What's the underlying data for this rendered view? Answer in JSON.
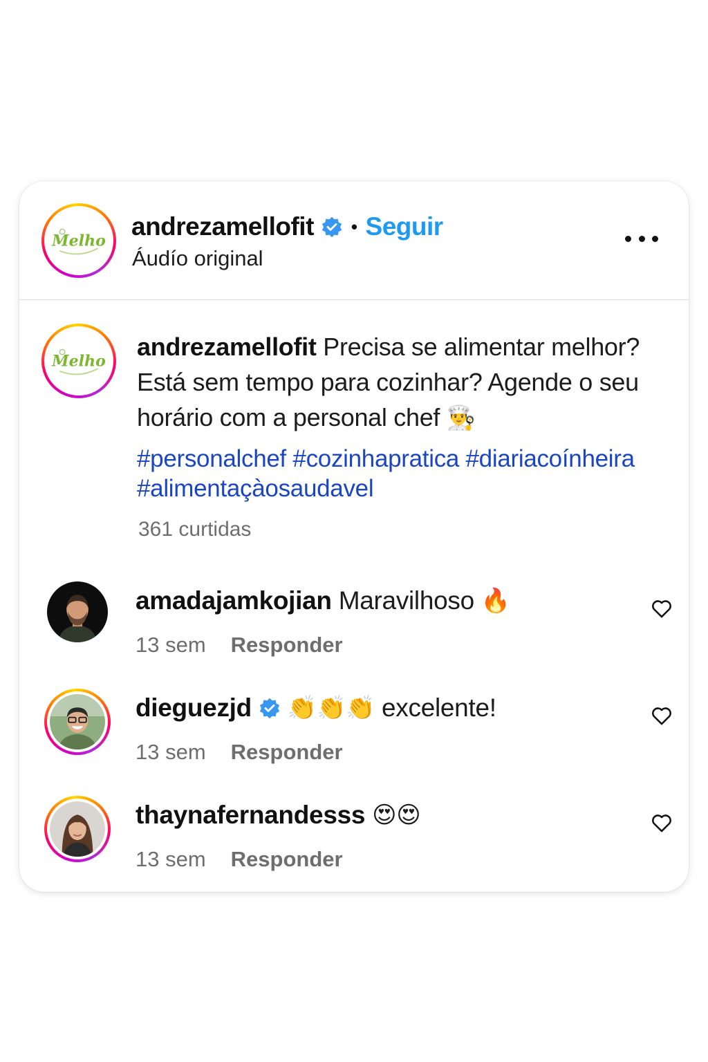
{
  "post": {
    "username": "andrezamellofit",
    "verified": true,
    "separator": "•",
    "follow_label": "Seguir",
    "audio_label": "Áudío original",
    "avatar_logo_text": "Melho",
    "more_icon": "more-horizontal-icon"
  },
  "caption": {
    "username": "andrezamellofit",
    "text": "Precisa se alimentar melhor? Está sem tempo para cozinhar? Agende o seu horário com a personal chef",
    "emoji": "👨‍🍳",
    "hashtags": [
      "#personalchef",
      "#cozinhapratica",
      "#diariacoínheira",
      "#alimentaçàosaudavel"
    ],
    "likes": "361 curtidas"
  },
  "comments": [
    {
      "username": "amadajamkojian",
      "verified": false,
      "text": "Maravilhoso",
      "emoji": "🔥",
      "time": "13 sem",
      "reply_label": "Responder"
    },
    {
      "username": "dieguezjd",
      "verified": true,
      "emoji": "👏👏👏",
      "text": "excelente!",
      "time": "13 sem",
      "reply_label": "Responder"
    },
    {
      "username": "thaynafernandesss",
      "verified": false,
      "emoji": "😍😍",
      "text": "",
      "time": "13 sem",
      "reply_label": "Responder"
    }
  ],
  "colors": {
    "accent_blue": "#1e9bf0",
    "hashtag_blue": "#1b46c2",
    "verified_blue": "#3897f0",
    "muted_gray": "#6e6e6e"
  }
}
